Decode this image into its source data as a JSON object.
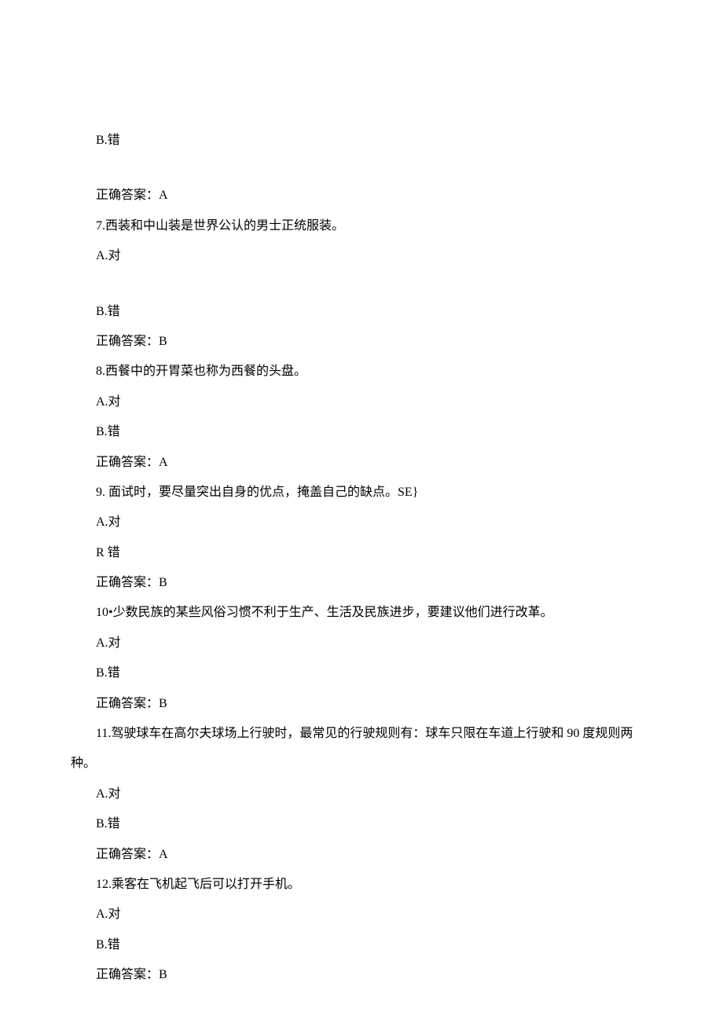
{
  "lines": [
    {
      "text": "B.错",
      "indent": true,
      "gapAbove": false
    },
    {
      "text": "正确答案：A",
      "indent": true,
      "gapAbove": true
    },
    {
      "text": "7.西装和中山装是世界公认的男士正统服装。",
      "indent": true,
      "gapAbove": false
    },
    {
      "text": "A.对",
      "indent": true,
      "gapAbove": false
    },
    {
      "text": "B.错",
      "indent": true,
      "gapAbove": true
    },
    {
      "text": "正确答案：B",
      "indent": true,
      "gapAbove": false
    },
    {
      "text": "8.西餐中的开胃菜也称为西餐的头盘。",
      "indent": true,
      "gapAbove": false
    },
    {
      "text": "A.对",
      "indent": true,
      "gapAbove": false
    },
    {
      "text": "B.错",
      "indent": true,
      "gapAbove": false
    },
    {
      "text": "正确答案：A",
      "indent": true,
      "gapAbove": false
    },
    {
      "text": "9. 面试时，要尽量突出自身的优点，掩盖自己的缺点。SE}",
      "indent": true,
      "gapAbove": false
    },
    {
      "text": "A.对",
      "indent": true,
      "gapAbove": false
    },
    {
      "text": "R 错",
      "indent": true,
      "gapAbove": false
    },
    {
      "text": "正确答案：B",
      "indent": true,
      "gapAbove": false
    },
    {
      "text": "10•少数民族的某些风俗习惯不利于生产、生活及民族进步，要建议他们进行改革。",
      "indent": true,
      "gapAbove": false,
      "hanging": true
    },
    {
      "text": "A.对",
      "indent": true,
      "gapAbove": false
    },
    {
      "text": "B.错",
      "indent": true,
      "gapAbove": false
    },
    {
      "text": "正确答案：B",
      "indent": true,
      "gapAbove": false
    },
    {
      "text": "11.驾驶球车在高尔夫球场上行驶时，最常见的行驶规则有：球车只限在车道上行驶和 90 度规则两种。",
      "indent": true,
      "gapAbove": false,
      "hanging": true
    },
    {
      "text": "A.对",
      "indent": true,
      "gapAbove": false
    },
    {
      "text": "B.错",
      "indent": true,
      "gapAbove": false
    },
    {
      "text": "正确答案：A",
      "indent": true,
      "gapAbove": false
    },
    {
      "text": "12.乘客在飞机起飞后可以打开手机。",
      "indent": true,
      "gapAbove": false
    },
    {
      "text": "A.对",
      "indent": true,
      "gapAbove": false
    },
    {
      "text": "B.错",
      "indent": true,
      "gapAbove": false
    },
    {
      "text": "正确答案：B",
      "indent": true,
      "gapAbove": false
    }
  ]
}
